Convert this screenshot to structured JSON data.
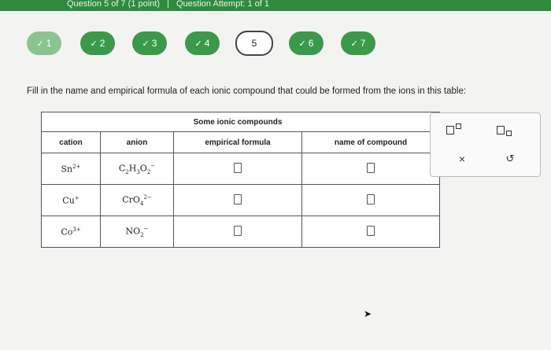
{
  "header": {
    "left": "Question 5 of 7 (1 point)",
    "separator": "|",
    "right": "Question Attempt: 1 of 1"
  },
  "nav": {
    "check_glyph": "✓",
    "questions": [
      {
        "label": "1",
        "status": "done"
      },
      {
        "label": "2",
        "status": "done"
      },
      {
        "label": "3",
        "status": "done"
      },
      {
        "label": "4",
        "status": "done"
      },
      {
        "label": "5",
        "status": "current"
      },
      {
        "label": "6",
        "status": "done"
      },
      {
        "label": "7",
        "status": "done"
      }
    ]
  },
  "prompt": "Fill in the name and empirical formula of each ionic compound that could be formed from the ions in this table:",
  "table": {
    "caption": "Some ionic compounds",
    "headers": {
      "cation": "cation",
      "anion": "anion",
      "formula": "empirical formula",
      "name": "name of compound"
    },
    "rows": [
      {
        "cation": "Sn",
        "cation_charge": "2+",
        "anion_parts": [
          "C",
          "2",
          "H",
          "3",
          "O",
          "2"
        ],
        "anion_charge": "−"
      },
      {
        "cation": "Cu",
        "cation_charge": "+",
        "anion_parts": [
          "CrO",
          "4"
        ],
        "anion_charge": "2−"
      },
      {
        "cation": "Co",
        "cation_charge": "3+",
        "anion_parts": [
          "NO",
          "2"
        ],
        "anion_charge": "−"
      }
    ]
  },
  "toolbar": {
    "clear_glyph": "×",
    "undo_glyph": "↺"
  },
  "colors": {
    "header_green": "#2f8a3e",
    "done_green": "#3a9a4a"
  }
}
